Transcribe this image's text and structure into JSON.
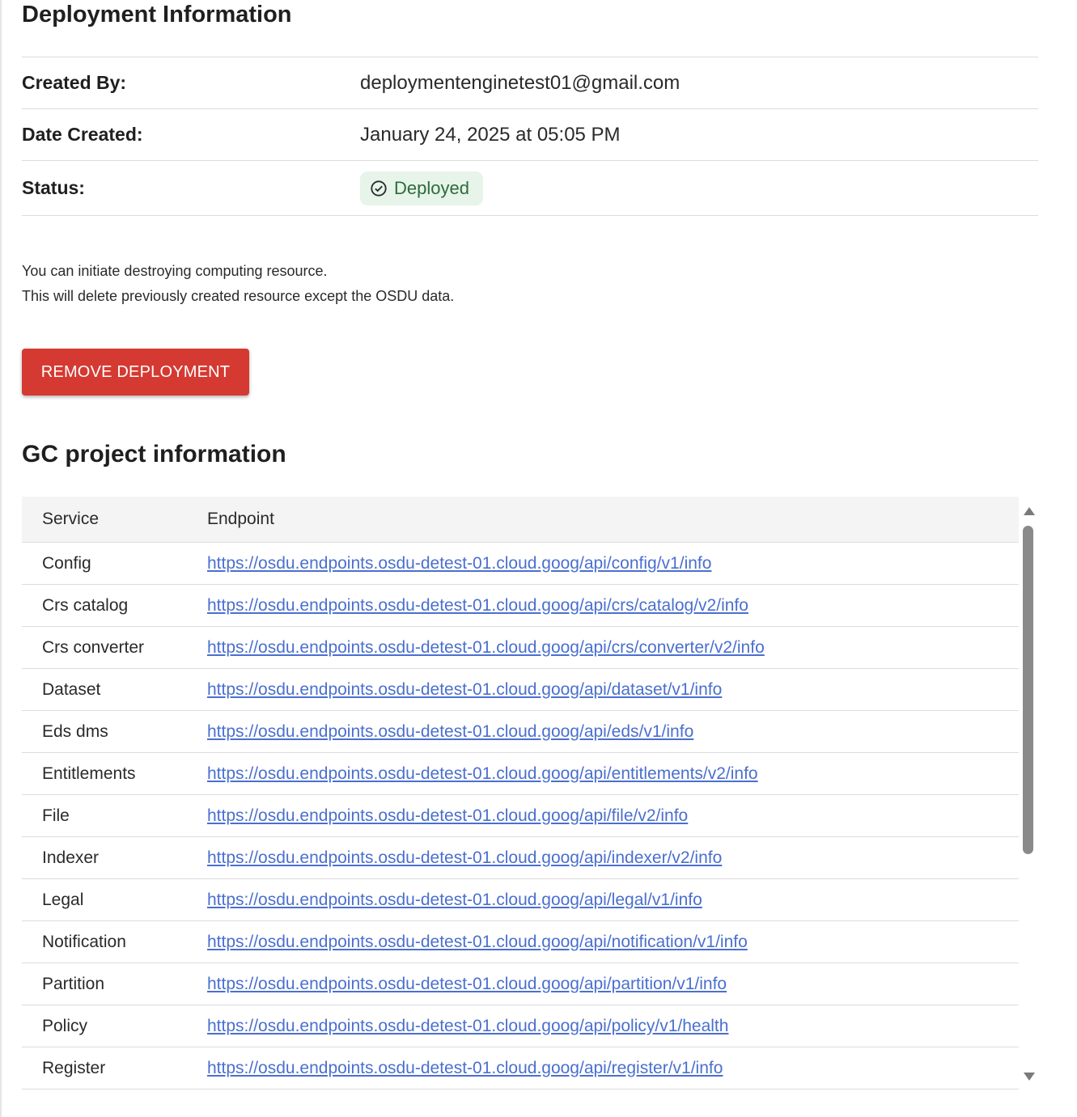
{
  "deployment": {
    "title": "Deployment Information",
    "created_by_label": "Created By:",
    "created_by": "deploymentenginetest01@gmail.com",
    "date_created_label": "Date Created:",
    "date_created": "January 24, 2025 at 05:05 PM",
    "status_label": "Status:",
    "status": "Deployed",
    "status_icon": "check-circle-icon",
    "note_line1": "You can initiate destroying computing resource.",
    "note_line2": "This will delete previously created resource except the OSDU data.",
    "remove_button": "REMOVE DEPLOYMENT"
  },
  "colors": {
    "remove_button": "#d43a32",
    "status_chip_bg": "#e6f4ea",
    "status_chip_text": "#2e6b3a",
    "link": "#4a6fcf"
  },
  "gc_project": {
    "title": "GC project information",
    "columns": [
      "Service",
      "Endpoint"
    ],
    "rows": [
      {
        "service": "Config",
        "endpoint": "https://osdu.endpoints.osdu-detest-01.cloud.goog/api/config/v1/info"
      },
      {
        "service": "Crs catalog",
        "endpoint": "https://osdu.endpoints.osdu-detest-01.cloud.goog/api/crs/catalog/v2/info"
      },
      {
        "service": "Crs converter",
        "endpoint": "https://osdu.endpoints.osdu-detest-01.cloud.goog/api/crs/converter/v2/info"
      },
      {
        "service": "Dataset",
        "endpoint": "https://osdu.endpoints.osdu-detest-01.cloud.goog/api/dataset/v1/info"
      },
      {
        "service": "Eds dms",
        "endpoint": "https://osdu.endpoints.osdu-detest-01.cloud.goog/api/eds/v1/info"
      },
      {
        "service": "Entitlements",
        "endpoint": "https://osdu.endpoints.osdu-detest-01.cloud.goog/api/entitlements/v2/info"
      },
      {
        "service": "File",
        "endpoint": "https://osdu.endpoints.osdu-detest-01.cloud.goog/api/file/v2/info"
      },
      {
        "service": "Indexer",
        "endpoint": "https://osdu.endpoints.osdu-detest-01.cloud.goog/api/indexer/v2/info"
      },
      {
        "service": "Legal",
        "endpoint": "https://osdu.endpoints.osdu-detest-01.cloud.goog/api/legal/v1/info"
      },
      {
        "service": "Notification",
        "endpoint": "https://osdu.endpoints.osdu-detest-01.cloud.goog/api/notification/v1/info"
      },
      {
        "service": "Partition",
        "endpoint": "https://osdu.endpoints.osdu-detest-01.cloud.goog/api/partition/v1/info"
      },
      {
        "service": "Policy",
        "endpoint": "https://osdu.endpoints.osdu-detest-01.cloud.goog/api/policy/v1/health"
      },
      {
        "service": "Register",
        "endpoint": "https://osdu.endpoints.osdu-detest-01.cloud.goog/api/register/v1/info"
      }
    ]
  }
}
